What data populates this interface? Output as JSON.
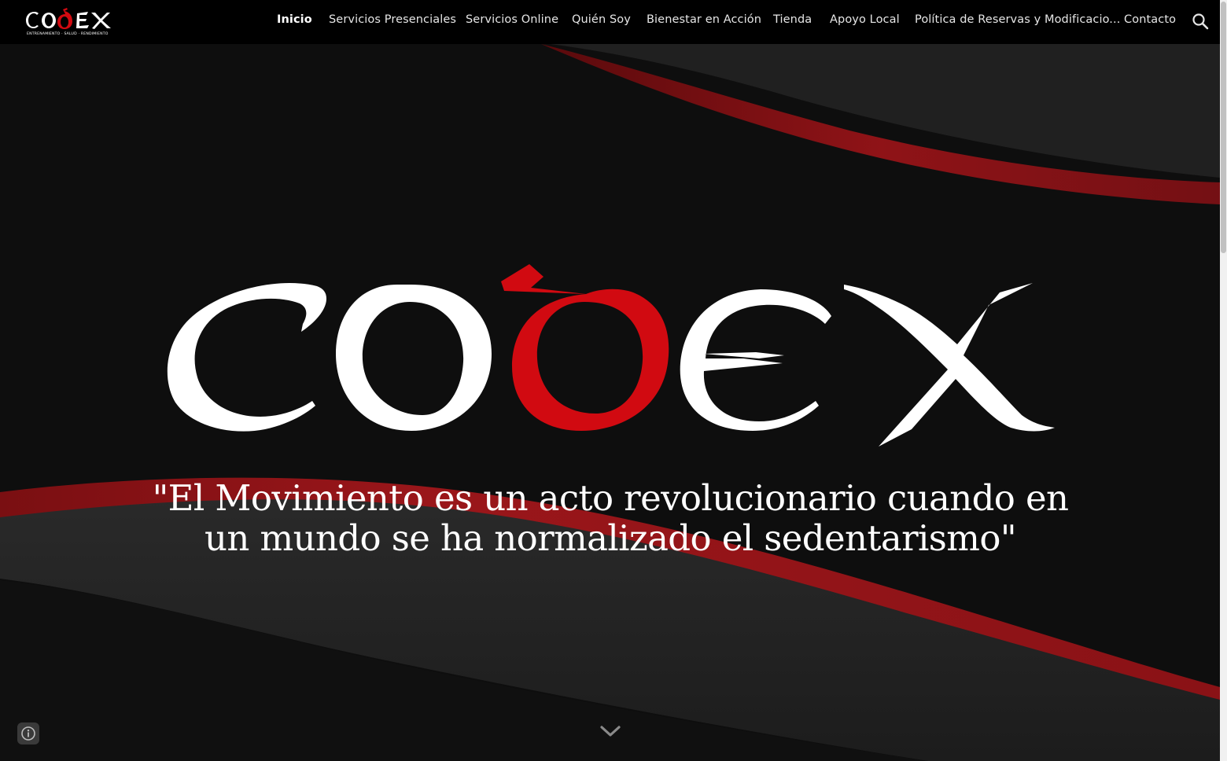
{
  "brand": {
    "logo_word": "CODEX",
    "tagline": "ENTRENAMIENTO · SALUD · RENDIMIENTO",
    "icon": "codex-logo"
  },
  "nav": {
    "items": [
      {
        "label": "Inicio",
        "active": true
      },
      {
        "label": "Servicios Presenciales",
        "active": false
      },
      {
        "label": "Servicios Online",
        "active": false
      },
      {
        "label": "Quién Soy",
        "active": false
      },
      {
        "label": "Bienestar en Acción",
        "active": false
      },
      {
        "label": "Tienda",
        "active": false
      },
      {
        "label": "Apoyo Local",
        "active": false
      },
      {
        "label": "Política de Reservas y Modificacio...",
        "active": false
      },
      {
        "label": "Contacto",
        "active": false
      }
    ],
    "search_icon": "search-icon"
  },
  "hero": {
    "logo_word": "CODEX",
    "quote_line1": "\"El Movimiento es un acto revolucionario cuando en",
    "quote_line2": "un mundo se ha normalizado el sedentarismo\"",
    "scroll_icon": "chevron-down-icon",
    "info_icon": "info-icon"
  },
  "colors": {
    "background": "#0e0e0e",
    "accent_red": "#d10a11",
    "swoosh_red": "#8c1216",
    "nav_bg": "#000000",
    "text": "#ffffff"
  }
}
